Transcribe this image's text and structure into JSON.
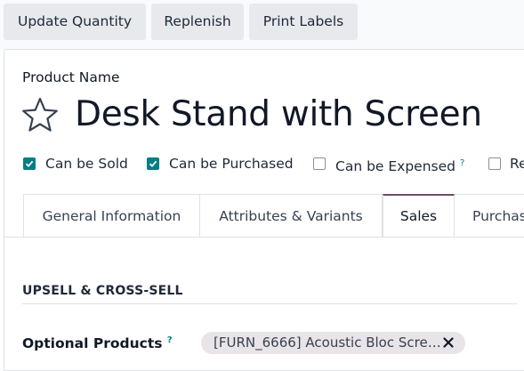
{
  "toolbar": {
    "update_quantity": "Update Quantity",
    "replenish": "Replenish",
    "print_labels": "Print Labels"
  },
  "form": {
    "product_name_label": "Product Name",
    "product_name": "Desk Stand with Screen",
    "checkboxes": [
      {
        "label": "Can be Sold",
        "checked": true
      },
      {
        "label": "Can be Purchased",
        "checked": true
      },
      {
        "label": "Can be Expensed",
        "checked": false,
        "help": "?"
      },
      {
        "label": "Re",
        "checked": false
      }
    ],
    "tabs": [
      {
        "label": "General Information",
        "active": false
      },
      {
        "label": "Attributes & Variants",
        "active": false
      },
      {
        "label": "Sales",
        "active": true
      },
      {
        "label": "Purchase",
        "active": false
      }
    ],
    "section_title": "UPSELL & CROSS-SELL",
    "optional_products_label": "Optional Products",
    "optional_products_help": "?",
    "optional_products_tag": "[FURN_6666] Acoustic Bloc Scre…"
  },
  "colors": {
    "accent": "#017e84",
    "tab_active_border": "#714b67",
    "tag_bg": "#e9e4e7"
  }
}
